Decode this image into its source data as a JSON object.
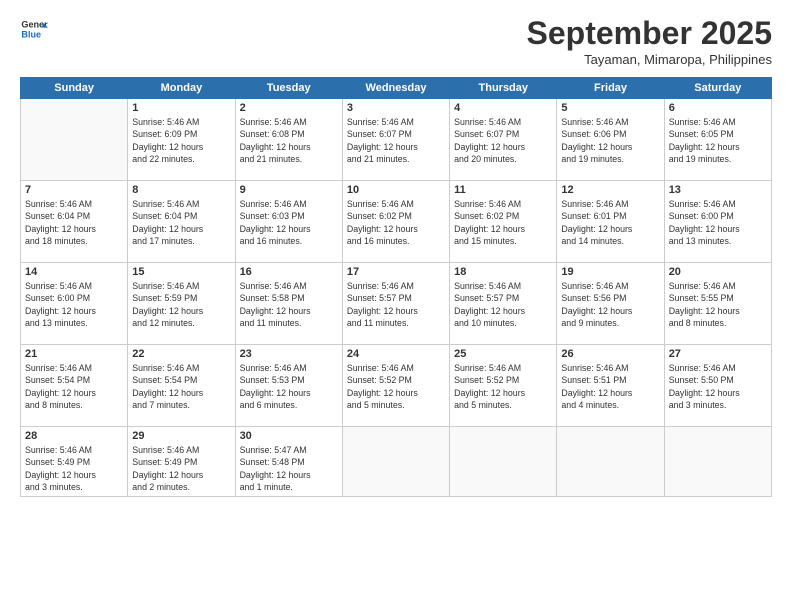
{
  "header": {
    "logo_line1": "General",
    "logo_line2": "Blue",
    "month_title": "September 2025",
    "location": "Tayaman, Mimaropa, Philippines"
  },
  "days_of_week": [
    "Sunday",
    "Monday",
    "Tuesday",
    "Wednesday",
    "Thursday",
    "Friday",
    "Saturday"
  ],
  "weeks": [
    [
      {
        "date": "",
        "text": ""
      },
      {
        "date": "1",
        "text": "Sunrise: 5:46 AM\nSunset: 6:09 PM\nDaylight: 12 hours\nand 22 minutes."
      },
      {
        "date": "2",
        "text": "Sunrise: 5:46 AM\nSunset: 6:08 PM\nDaylight: 12 hours\nand 21 minutes."
      },
      {
        "date": "3",
        "text": "Sunrise: 5:46 AM\nSunset: 6:07 PM\nDaylight: 12 hours\nand 21 minutes."
      },
      {
        "date": "4",
        "text": "Sunrise: 5:46 AM\nSunset: 6:07 PM\nDaylight: 12 hours\nand 20 minutes."
      },
      {
        "date": "5",
        "text": "Sunrise: 5:46 AM\nSunset: 6:06 PM\nDaylight: 12 hours\nand 19 minutes."
      },
      {
        "date": "6",
        "text": "Sunrise: 5:46 AM\nSunset: 6:05 PM\nDaylight: 12 hours\nand 19 minutes."
      }
    ],
    [
      {
        "date": "7",
        "text": "Sunrise: 5:46 AM\nSunset: 6:04 PM\nDaylight: 12 hours\nand 18 minutes."
      },
      {
        "date": "8",
        "text": "Sunrise: 5:46 AM\nSunset: 6:04 PM\nDaylight: 12 hours\nand 17 minutes."
      },
      {
        "date": "9",
        "text": "Sunrise: 5:46 AM\nSunset: 6:03 PM\nDaylight: 12 hours\nand 16 minutes."
      },
      {
        "date": "10",
        "text": "Sunrise: 5:46 AM\nSunset: 6:02 PM\nDaylight: 12 hours\nand 16 minutes."
      },
      {
        "date": "11",
        "text": "Sunrise: 5:46 AM\nSunset: 6:02 PM\nDaylight: 12 hours\nand 15 minutes."
      },
      {
        "date": "12",
        "text": "Sunrise: 5:46 AM\nSunset: 6:01 PM\nDaylight: 12 hours\nand 14 minutes."
      },
      {
        "date": "13",
        "text": "Sunrise: 5:46 AM\nSunset: 6:00 PM\nDaylight: 12 hours\nand 13 minutes."
      }
    ],
    [
      {
        "date": "14",
        "text": "Sunrise: 5:46 AM\nSunset: 6:00 PM\nDaylight: 12 hours\nand 13 minutes."
      },
      {
        "date": "15",
        "text": "Sunrise: 5:46 AM\nSunset: 5:59 PM\nDaylight: 12 hours\nand 12 minutes."
      },
      {
        "date": "16",
        "text": "Sunrise: 5:46 AM\nSunset: 5:58 PM\nDaylight: 12 hours\nand 11 minutes."
      },
      {
        "date": "17",
        "text": "Sunrise: 5:46 AM\nSunset: 5:57 PM\nDaylight: 12 hours\nand 11 minutes."
      },
      {
        "date": "18",
        "text": "Sunrise: 5:46 AM\nSunset: 5:57 PM\nDaylight: 12 hours\nand 10 minutes."
      },
      {
        "date": "19",
        "text": "Sunrise: 5:46 AM\nSunset: 5:56 PM\nDaylight: 12 hours\nand 9 minutes."
      },
      {
        "date": "20",
        "text": "Sunrise: 5:46 AM\nSunset: 5:55 PM\nDaylight: 12 hours\nand 8 minutes."
      }
    ],
    [
      {
        "date": "21",
        "text": "Sunrise: 5:46 AM\nSunset: 5:54 PM\nDaylight: 12 hours\nand 8 minutes."
      },
      {
        "date": "22",
        "text": "Sunrise: 5:46 AM\nSunset: 5:54 PM\nDaylight: 12 hours\nand 7 minutes."
      },
      {
        "date": "23",
        "text": "Sunrise: 5:46 AM\nSunset: 5:53 PM\nDaylight: 12 hours\nand 6 minutes."
      },
      {
        "date": "24",
        "text": "Sunrise: 5:46 AM\nSunset: 5:52 PM\nDaylight: 12 hours\nand 5 minutes."
      },
      {
        "date": "25",
        "text": "Sunrise: 5:46 AM\nSunset: 5:52 PM\nDaylight: 12 hours\nand 5 minutes."
      },
      {
        "date": "26",
        "text": "Sunrise: 5:46 AM\nSunset: 5:51 PM\nDaylight: 12 hours\nand 4 minutes."
      },
      {
        "date": "27",
        "text": "Sunrise: 5:46 AM\nSunset: 5:50 PM\nDaylight: 12 hours\nand 3 minutes."
      }
    ],
    [
      {
        "date": "28",
        "text": "Sunrise: 5:46 AM\nSunset: 5:49 PM\nDaylight: 12 hours\nand 3 minutes."
      },
      {
        "date": "29",
        "text": "Sunrise: 5:46 AM\nSunset: 5:49 PM\nDaylight: 12 hours\nand 2 minutes."
      },
      {
        "date": "30",
        "text": "Sunrise: 5:47 AM\nSunset: 5:48 PM\nDaylight: 12 hours\nand 1 minute."
      },
      {
        "date": "",
        "text": ""
      },
      {
        "date": "",
        "text": ""
      },
      {
        "date": "",
        "text": ""
      },
      {
        "date": "",
        "text": ""
      }
    ]
  ]
}
